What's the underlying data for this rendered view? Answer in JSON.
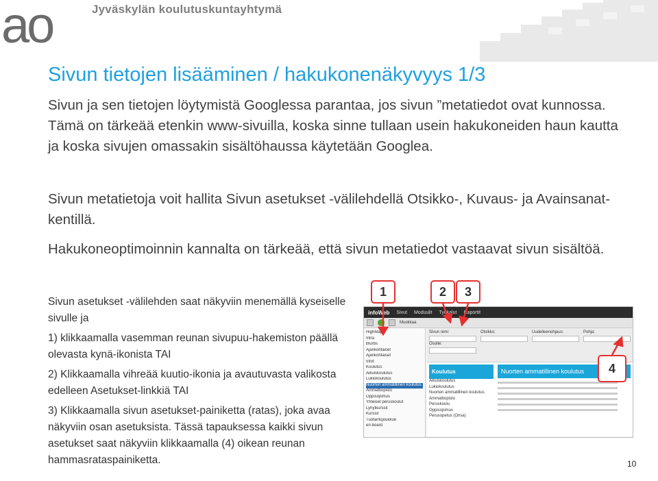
{
  "header": {
    "logo_text": "ao",
    "org_name": "Jyväskylän koulutuskuntayhtymä",
    "accent_color": "#1fa0dd"
  },
  "slide": {
    "title": "Sivun tietojen lisääminen / hakukonenäkyvyys 1/3",
    "paragraphs": [
      "Sivun ja sen tietojen löytymistä Googlessa parantaa, jos sivun ”metatiedot ovat kunnossa. Tämä on tärkeää etenkin www-sivuilla, koska sinne tullaan usein hakukoneiden haun kautta ja koska sivujen omassakin sisältöhaussa käytetään Googlea.",
      "Sivun metatietoja voit hallita Sivun asetukset -välilehdellä Otsikko-, Kuvaus- ja Avainsanat-kentillä.",
      "Hakukoneoptimoinnin kannalta on tärkeää, että sivun metatiedot vastaavat sivun sisältöä."
    ],
    "steps": [
      "Sivun asetukset -välilehden saat näkyviin menemällä kyseiselle sivulle ja",
      "1) klikkaamalla vasemman reunan sivupuu-hakemiston päällä olevasta kynä-ikonista TAI",
      "2) Klikkaamalla vihreää kuutio-ikonia ja avautuvasta valikosta edelleen Asetukset-linkkiä TAI",
      "3) Klikkaamalla sivun asetukset-painiketta (ratas), joka avaa näkyviin osan asetuksista. Tässä tapauksessa kaikki sivun asetukset saat näkyviin klikkaamalla (4) oikean reunan hammasrataspainiketta."
    ],
    "callouts": [
      "1",
      "2",
      "3",
      "4"
    ],
    "page_number": "10"
  },
  "screenshot": {
    "topbar": [
      "infoWeb",
      "Sivut",
      "Moduulit",
      "Työkalut",
      "Raportit"
    ],
    "toolbar_label": "Muokkaa",
    "tree": [
      "HighMap",
      "Intra",
      "Blurbs",
      "Ajankohtaiset",
      "Ajankohtaiset",
      "Infot",
      "Koulutus",
      "Aikuiskoulutus",
      "Lukiokoulutus",
      "Nuorten ammatillinen koulutus",
      "Ammattiopisto",
      "Oppisopimus",
      "Yhteiset peruskoulut",
      "Lyhytkurssit",
      "Kurssit",
      "Tuotantojoukkue",
      "en-board"
    ],
    "settings_labels": [
      "Sivun nimi:",
      "Osoite:",
      "Otsikko:",
      "Uudelleenohjaus:",
      "Pohja:"
    ],
    "sidebar_title": "Koulutus",
    "sidebar_items": [
      "Aikuiskoulutus",
      "Lukiokoulutus",
      "Nuorten ammatillinen koulutus",
      "Ammattiopisto",
      "Peruskoulu",
      "Oppisopimus",
      "Perusopetus (Onsa)"
    ],
    "article_title": "Nuorten ammatillinen koulutus"
  }
}
